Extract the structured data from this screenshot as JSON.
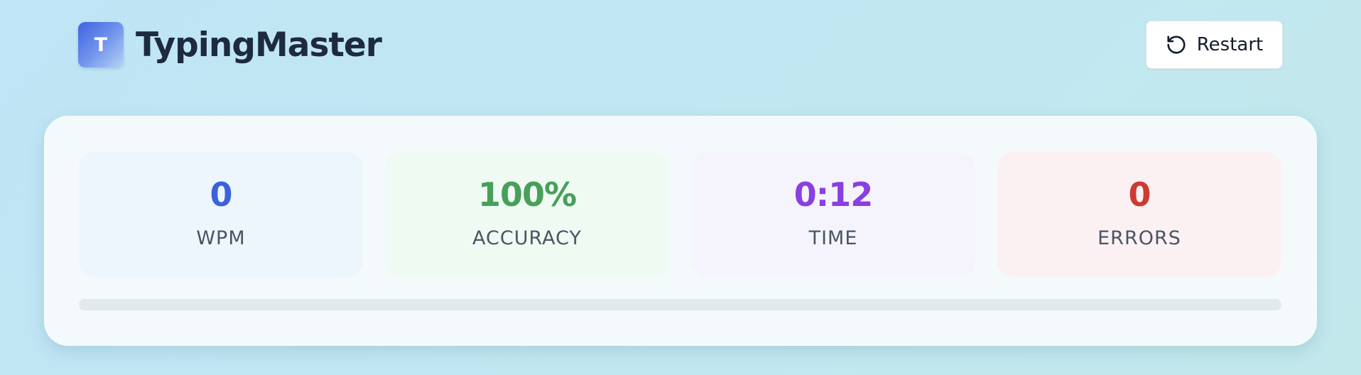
{
  "app": {
    "logo_letter": "T",
    "name": "TypingMaster"
  },
  "toolbar": {
    "restart_label": "Restart",
    "restart_icon": "restart-icon"
  },
  "stats": {
    "wpm": {
      "value": "0",
      "label": "WPM",
      "color": "#3a62db"
    },
    "accuracy": {
      "value": "100%",
      "label": "ACCURACY",
      "color": "#47a058"
    },
    "time": {
      "value": "0:12",
      "label": "TIME",
      "color": "#8a3fe0"
    },
    "errors": {
      "value": "0",
      "label": "ERRORS",
      "color": "#cd3a32"
    }
  },
  "progress": {
    "fraction": 0
  },
  "colors": {
    "accent": "#3f63e0",
    "heading": "#1e2a3e"
  }
}
